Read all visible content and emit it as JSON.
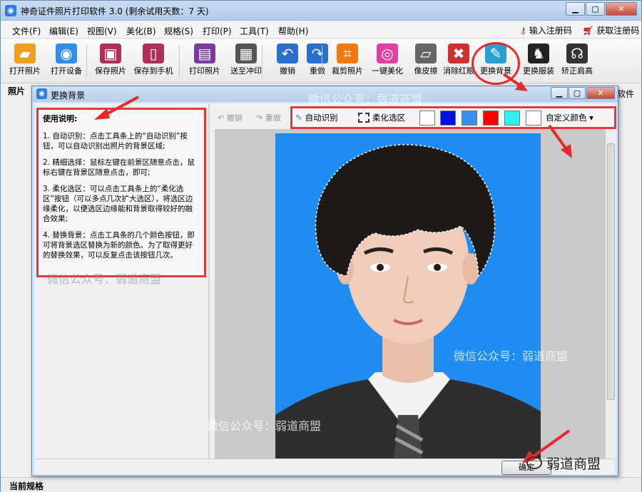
{
  "app": {
    "title": "神奇证件照片打印软件 3.0 (剩余试用天数：7 天)",
    "menu": [
      "文件(F)",
      "编辑(E)",
      "视图(V)",
      "美化(B)",
      "规格(S)",
      "打印(P)",
      "工具(T)",
      "帮助(H)"
    ],
    "register_code": "输入注册码",
    "get_code": "获取注册码",
    "toolbar": [
      {
        "label": "打开照片",
        "icon": "folder-open-icon",
        "color": "#f0a020"
      },
      {
        "label": "打开设备",
        "icon": "camera-icon",
        "color": "#2f8ee8"
      },
      {
        "label": "保存照片",
        "icon": "save-icon",
        "color": "#b0305a"
      },
      {
        "label": "保存到手机",
        "icon": "phone-icon",
        "color": "#b0305a"
      },
      {
        "label": "打印照片",
        "icon": "printer-icon",
        "color": "#7a3c9a"
      },
      {
        "label": "送至冲印",
        "icon": "print-service-icon",
        "color": "#555555"
      },
      {
        "label": "撤销",
        "icon": "undo-icon",
        "color": "#2a6fd0"
      },
      {
        "label": "重做",
        "icon": "redo-icon",
        "color": "#2a6fd0"
      },
      {
        "label": "裁剪照片",
        "icon": "crop-icon",
        "color": "#f07a10"
      },
      {
        "label": "一键美化",
        "icon": "color-ring-icon",
        "color": "#e040a0"
      },
      {
        "label": "像皮擦",
        "icon": "eraser-icon",
        "color": "#666666"
      },
      {
        "label": "消除红眼",
        "icon": "redeye-icon",
        "color": "#d03030"
      },
      {
        "label": "更换背景",
        "icon": "brush-icon",
        "color": "#2a9fd0"
      },
      {
        "label": "更换服装",
        "icon": "suit-icon",
        "color": "#222222"
      },
      {
        "label": "矫正肩高",
        "icon": "shoulder-icon",
        "color": "#333333"
      }
    ],
    "left_pane_label": "照片",
    "right_pane_label": "软件",
    "status_label": "当前规格"
  },
  "dialog": {
    "title": "更换背景",
    "instructions": {
      "title": "使用说明:",
      "steps": [
        "1. 自动识别：点击工具条上的“自动识别”按钮，可以自动识别出照片的背景区域;",
        "2. 精细选择：鼠标左键在前景区随意点击，鼠标右键在背景区随意点击，即可;",
        "3. 柔化选区：可以点击工具条上的“柔化选区”按钮（可以多点几次扩大选区），将选区边缘柔化，以便选区边缘能和背景取得较好的融合效果;",
        "4. 替换背景：点击工具条的几个颜色按钮，即可将背景选区替换为新的颜色。为了取得更好的替换效果，可以反复点击该按钮几次。"
      ]
    },
    "undo": "撤销",
    "redo": "重做",
    "auto_detect": "自动识别",
    "soften": "柔化选区",
    "swatches": [
      "#ffffff",
      "#0010e0",
      "#3a8ee8",
      "#ff0000",
      "#30f0f0",
      "#ffffff"
    ],
    "custom_color": "自定义颜色",
    "ok": "确定",
    "photo_bg": "#1e8cf0"
  },
  "watermarks": [
    "微信公众号：弱道商盟",
    "微信公众号：弱道商盟",
    "微信公众号：弱道商盟",
    "微信公众号：弱道商盟"
  ],
  "wechat_badge": "弱道商盟"
}
